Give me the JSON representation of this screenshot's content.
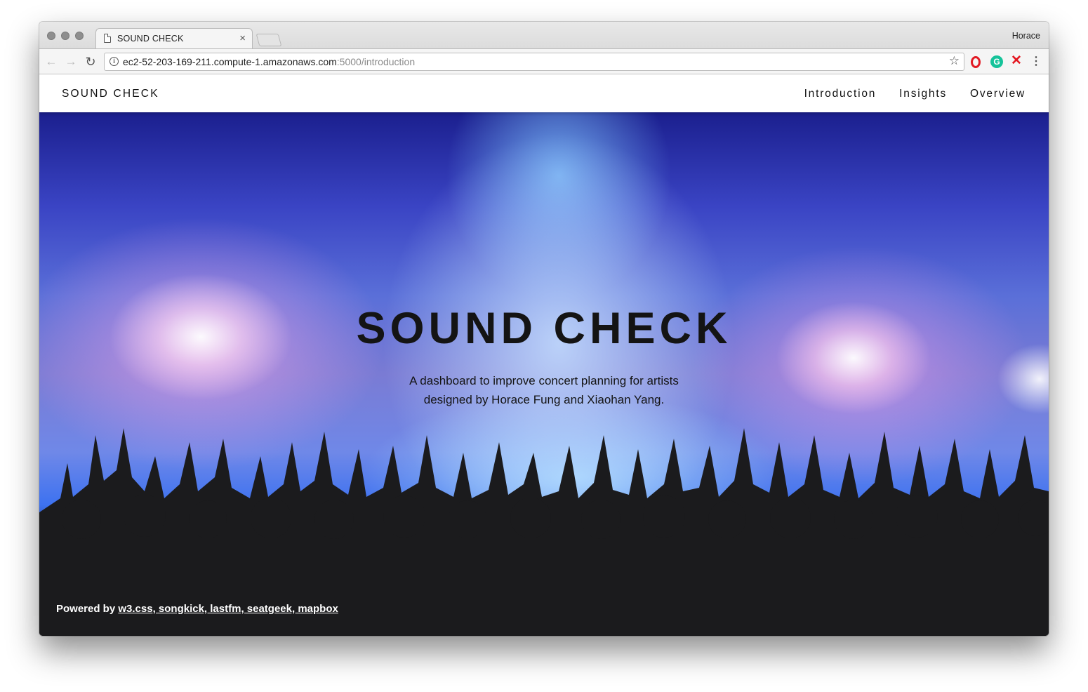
{
  "browser": {
    "tab_title": "SOUND CHECK",
    "tab_close": "×",
    "profile_name": "Horace",
    "url_host": "ec2-52-203-169-211.compute-1.amazonaws.com",
    "url_rest": ":5000/introduction",
    "icons": [
      "back-arrow-icon",
      "forward-arrow-icon",
      "reload-icon",
      "info-icon",
      "star-icon",
      "opera-icon",
      "grammarly-icon",
      "x-extension-icon",
      "menu-dots-icon"
    ]
  },
  "site": {
    "brand": "SOUND CHECK",
    "nav": [
      "Introduction",
      "Insights",
      "Overview"
    ],
    "hero_title": "SOUND CHECK",
    "hero_subtitle_line1": "A dashboard to improve concert planning for artists",
    "hero_subtitle_line2": "designed by Horace Fung and Xiaohan Yang.",
    "footer_prefix": "Powered by ",
    "footer_links": "w3.css, songkick, lastfm, seatgeek, mapbox"
  },
  "colors": {
    "nav_bg": "#ffffff",
    "text_dark": "#141414",
    "hero_blue": "#3a44c4",
    "crowd": "#1b1b1d"
  }
}
